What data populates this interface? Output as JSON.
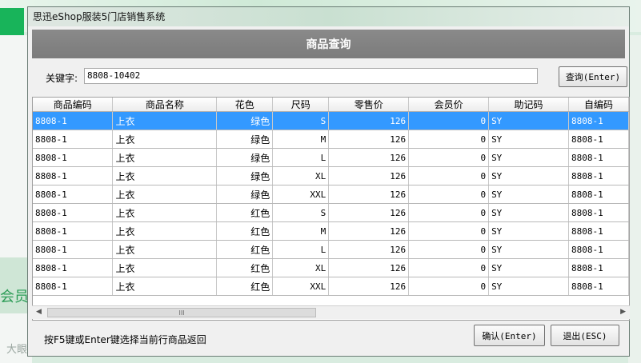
{
  "window": {
    "title": "思迅eShop服装5门店销售系统"
  },
  "dialog": {
    "heading": "商品查询"
  },
  "search": {
    "label": "关键字:",
    "value": "8808-10402",
    "button": "查询(Enter)"
  },
  "grid": {
    "columns": [
      "商品编码",
      "商品名称",
      "花色",
      "尺码",
      "零售价",
      "会员价",
      "助记码",
      "自编码"
    ],
    "rows": [
      [
        "8808-1",
        "上衣",
        "绿色",
        "S",
        "126",
        "0",
        "SY",
        "8808-1"
      ],
      [
        "8808-1",
        "上衣",
        "绿色",
        "M",
        "126",
        "0",
        "SY",
        "8808-1"
      ],
      [
        "8808-1",
        "上衣",
        "绿色",
        "L",
        "126",
        "0",
        "SY",
        "8808-1"
      ],
      [
        "8808-1",
        "上衣",
        "绿色",
        "XL",
        "126",
        "0",
        "SY",
        "8808-1"
      ],
      [
        "8808-1",
        "上衣",
        "绿色",
        "XXL",
        "126",
        "0",
        "SY",
        "8808-1"
      ],
      [
        "8808-1",
        "上衣",
        "红色",
        "S",
        "126",
        "0",
        "SY",
        "8808-1"
      ],
      [
        "8808-1",
        "上衣",
        "红色",
        "M",
        "126",
        "0",
        "SY",
        "8808-1"
      ],
      [
        "8808-1",
        "上衣",
        "红色",
        "L",
        "126",
        "0",
        "SY",
        "8808-1"
      ],
      [
        "8808-1",
        "上衣",
        "红色",
        "XL",
        "126",
        "0",
        "SY",
        "8808-1"
      ],
      [
        "8808-1",
        "上衣",
        "红色",
        "XXL",
        "126",
        "0",
        "SY",
        "8808-1"
      ]
    ],
    "selected_row_index": 0,
    "selection_color": "#3399ff",
    "scroll_thumb_glyph": "III"
  },
  "footer": {
    "hint": "按F5键或Enter键选择当前行商品返回",
    "confirm_button": "确认(Enter)",
    "exit_button": "退出(ESC)"
  },
  "background": {
    "member_label": "会员",
    "watermark": "大眼睛图"
  }
}
